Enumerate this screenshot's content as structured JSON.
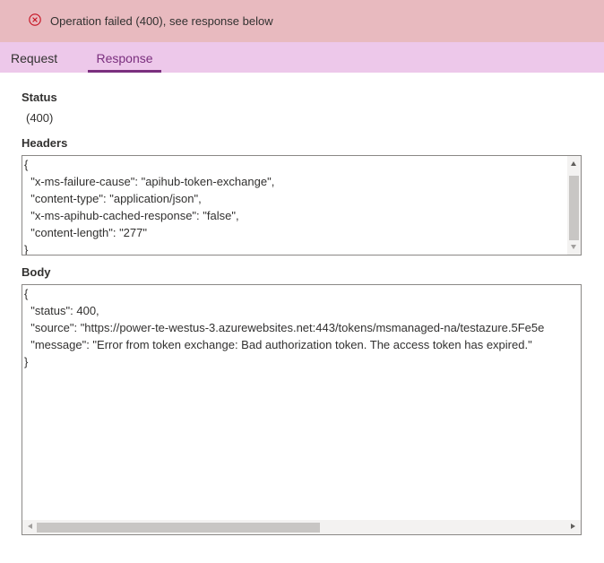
{
  "error": {
    "message": "Operation failed (400), see response below",
    "color": "#c50f1f"
  },
  "tabs": [
    {
      "label": "Request",
      "active": false
    },
    {
      "label": "Response",
      "active": true
    }
  ],
  "accent_color": "#7a2f7e",
  "status": {
    "label": "Status",
    "value": "(400)"
  },
  "headers": {
    "label": "Headers",
    "lines": [
      "{",
      "  \"x-ms-failure-cause\": \"apihub-token-exchange\",",
      "  \"content-type\": \"application/json\",",
      "  \"x-ms-apihub-cached-response\": \"false\",",
      "  \"content-length\": \"277\"",
      "}"
    ]
  },
  "body": {
    "label": "Body",
    "lines": [
      "{",
      "  \"status\": 400,",
      "  \"source\": \"https://power-te-westus-3.azurewebsites.net:443/tokens/msmanaged-na/testazure.5Fe5e",
      "  \"message\": \"Error from token exchange: Bad authorization token. The access token has expired.\"",
      "}"
    ]
  }
}
